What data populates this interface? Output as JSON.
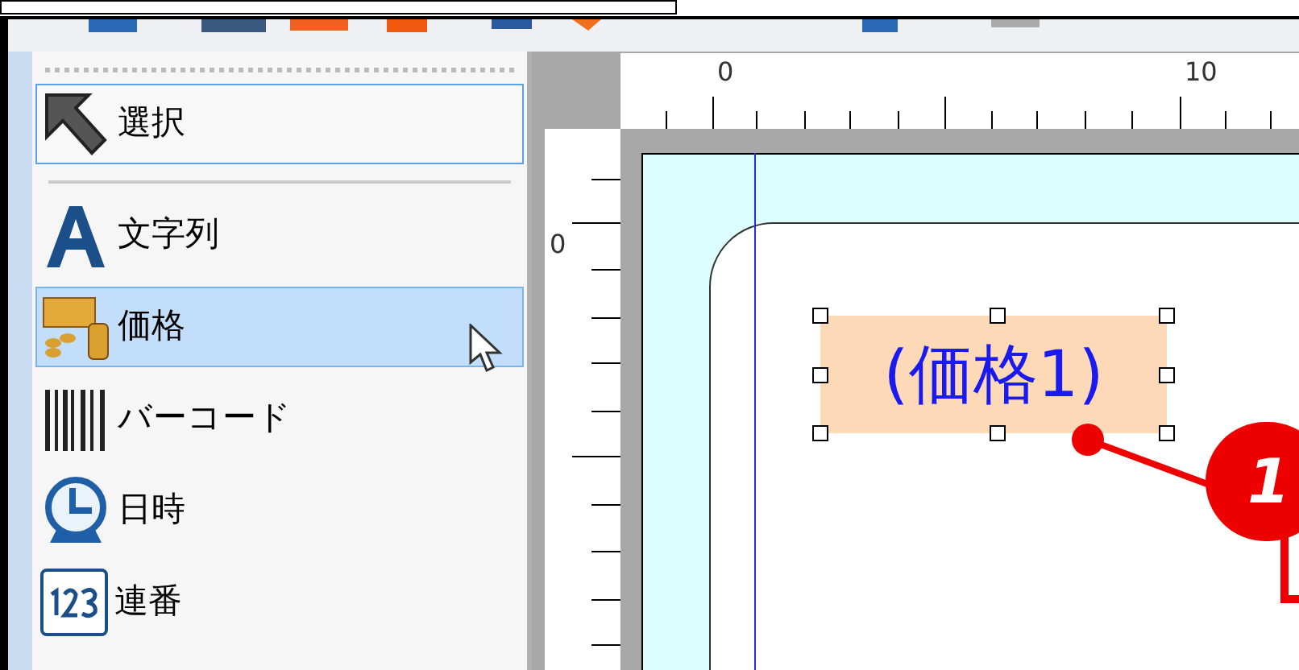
{
  "tool_panel": {
    "items": [
      {
        "kind": "pointer",
        "label": "選択",
        "selected": true,
        "hovered": false
      },
      {
        "kind": "text",
        "label": "文字列",
        "selected": false,
        "hovered": false
      },
      {
        "kind": "price",
        "label": "価格",
        "selected": false,
        "hovered": true
      },
      {
        "kind": "barcode",
        "label": "バーコード",
        "selected": false,
        "hovered": false
      },
      {
        "kind": "datetime",
        "label": "日時",
        "selected": false,
        "hovered": false
      },
      {
        "kind": "serial",
        "label": "連番",
        "selected": false,
        "hovered": false
      }
    ]
  },
  "canvas": {
    "top_ruler_labels": [
      "0",
      "10"
    ],
    "left_ruler_labels": [
      "0"
    ],
    "element": {
      "text": "(価格1)",
      "selected": true
    },
    "callout": "1"
  }
}
